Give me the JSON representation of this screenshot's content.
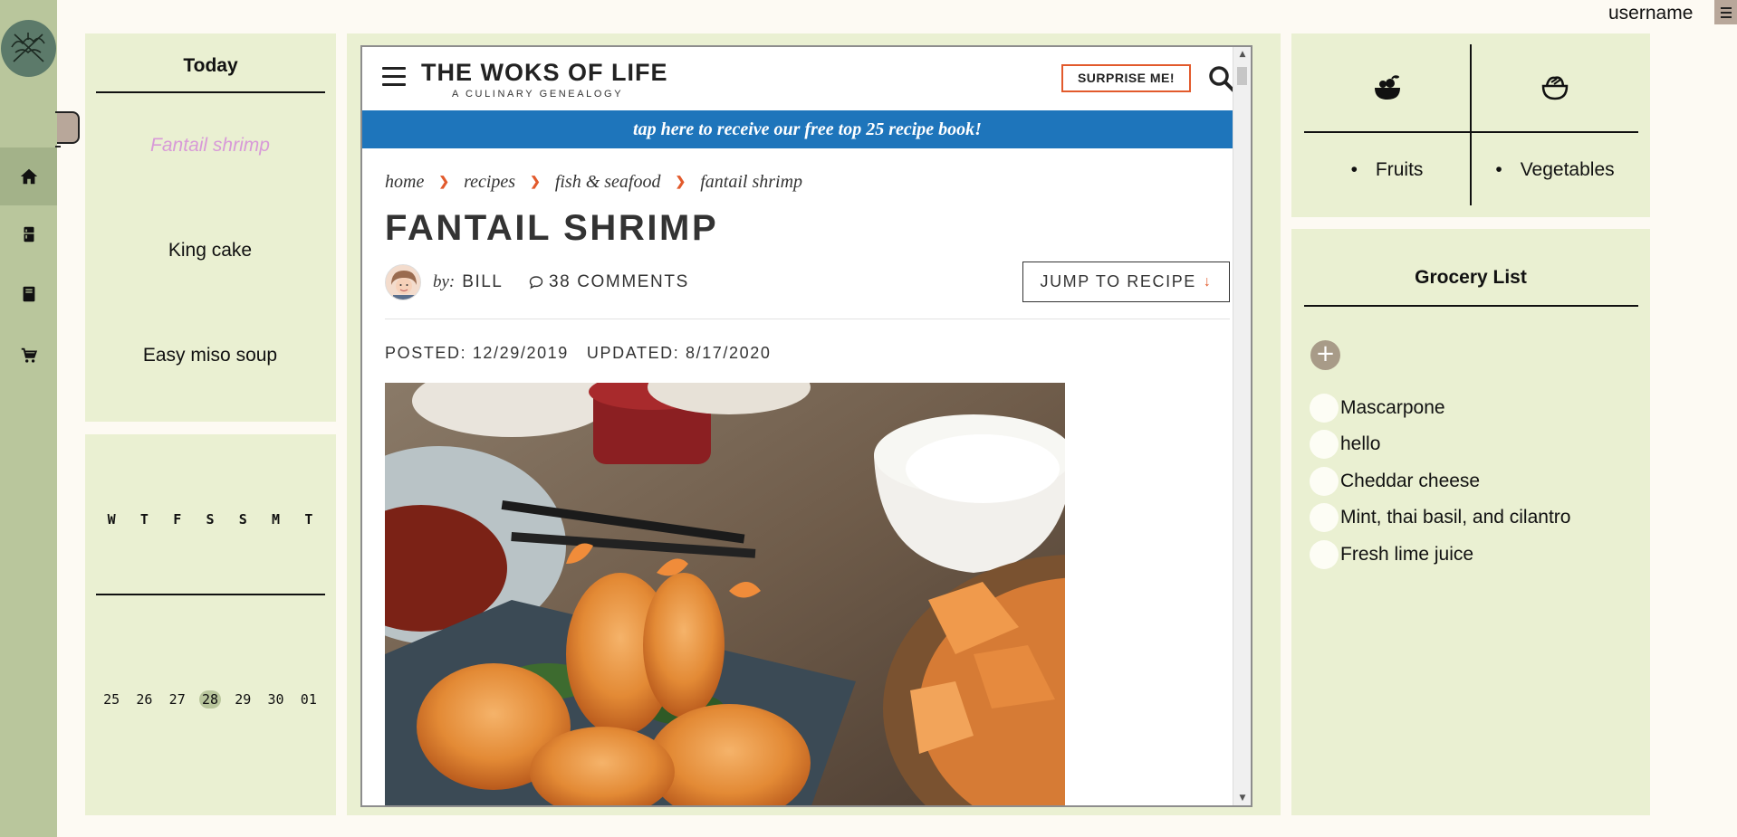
{
  "user": {
    "name": "username"
  },
  "sidebar": {
    "logo": "crossed-utensils-logo",
    "items": [
      {
        "icon": "home-icon",
        "active": true
      },
      {
        "icon": "fridge-icon",
        "active": false
      },
      {
        "icon": "book-icon",
        "active": false
      },
      {
        "icon": "cart-icon",
        "active": false
      }
    ]
  },
  "today": {
    "title": "Today",
    "meals": [
      "Fantail shrimp",
      "King cake",
      "Easy miso soup"
    ]
  },
  "calendar": {
    "weekdays": [
      "W",
      "T",
      "F",
      "S",
      "S",
      "M",
      "T"
    ],
    "dates": [
      "25",
      "26",
      "27",
      "28",
      "29",
      "30",
      "01"
    ],
    "today": "28"
  },
  "browser": {
    "site": {
      "title": "THE WOKS OF LIFE",
      "subtitle": "A CULINARY GENEALOGY",
      "surprise_button": "SURPRISE ME!",
      "banner": "tap here to receive our free top 25 recipe book!"
    },
    "breadcrumb": [
      "home",
      "recipes",
      "fish & seafood",
      "fantail shrimp"
    ],
    "post": {
      "title": "FANTAIL SHRIMP",
      "by_label": "by:",
      "author": "BILL",
      "comments": "38 COMMENTS",
      "jump_button": "JUMP TO RECIPE",
      "posted": "POSTED: 12/29/2019",
      "updated": "UPDATED: 8/17/2020"
    }
  },
  "categories": [
    {
      "icon": "fruit-bowl-icon",
      "label": "Fruits"
    },
    {
      "icon": "salad-bowl-icon",
      "label": "Vegetables"
    }
  ],
  "grocery": {
    "title": "Grocery List",
    "items": [
      "Mascarpone",
      "hello",
      "Cheddar cheese",
      "Mint, thai basil, and cilantro",
      "Fresh lime juice"
    ]
  },
  "colors": {
    "rail": "#b9c69c",
    "panel": "#eaf0d2",
    "highlight_meal": "#d89ad8",
    "site_accent": "#e25a2c",
    "banner": "#1e75bb"
  }
}
